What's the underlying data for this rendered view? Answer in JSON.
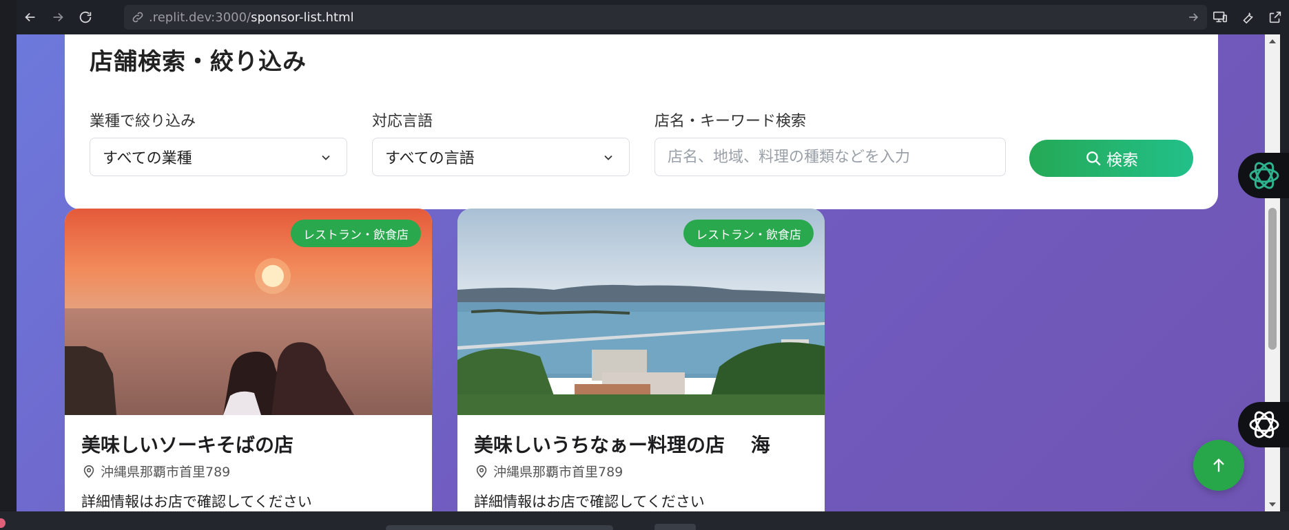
{
  "browser": {
    "url_host": ".replit.dev:3000/",
    "url_path": "sponsor-list.html"
  },
  "filter": {
    "title": "店舗検索・絞り込み",
    "category_label": "業種で絞り込み",
    "category_value": "すべての業種",
    "language_label": "対応言語",
    "language_value": "すべての言語",
    "keyword_label": "店名・キーワード検索",
    "keyword_placeholder": "店名、地域、料理の種類などを入力",
    "search_button": "検索"
  },
  "cards": [
    {
      "badge": "レストラン・飲食店",
      "title": "美味しいソーキそばの店",
      "address": "沖縄県那覇市首里789",
      "description": "詳細情報はお店で確認してください",
      "image": "sunset-sea-photo"
    },
    {
      "badge": "レストラン・飲食店",
      "title": "美味しいうちなぁー料理の店　 海",
      "address": "沖縄県那覇市首里789",
      "description": "詳細情報はお店で確認してください",
      "image": "bridge-sea-photo"
    }
  ],
  "icons": {
    "back": "arrow-left-icon",
    "forward": "arrow-right-icon",
    "reload": "reload-icon",
    "link": "link-icon",
    "go": "arrow-go-icon",
    "devices": "devices-icon",
    "wrench": "wrench-icon",
    "external": "external-link-icon",
    "chevron": "chevron-down-icon",
    "search": "search-icon",
    "pin": "location-pin-icon",
    "to_top": "arrow-up-icon",
    "assistant": "openai-logo-icon"
  },
  "colors": {
    "accent_green": "#27a74a",
    "background_purple": "#715bbf"
  }
}
